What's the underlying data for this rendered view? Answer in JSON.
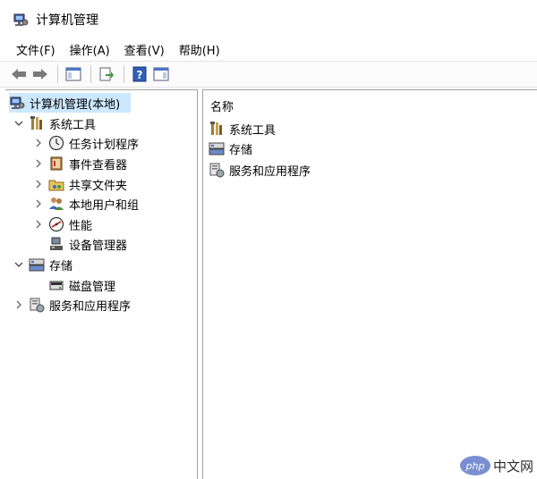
{
  "window": {
    "title": "计算机管理"
  },
  "menu": [
    {
      "label": "文件(F)"
    },
    {
      "label": "操作(A)"
    },
    {
      "label": "查看(V)"
    },
    {
      "label": "帮助(H)"
    }
  ],
  "toolbar": {
    "icons": [
      "back-icon",
      "forward-icon",
      "show-hide-tree-icon",
      "export-list-icon",
      "help-icon",
      "show-hide-action-pane-icon"
    ]
  },
  "tree": {
    "root": {
      "label": "计算机管理(本地)",
      "icon": "computer-management-icon"
    },
    "system_tools": {
      "label": "系统工具",
      "icon": "tools-icon",
      "children": [
        {
          "label": "任务计划程序",
          "icon": "clock-icon"
        },
        {
          "label": "事件查看器",
          "icon": "event-viewer-icon"
        },
        {
          "label": "共享文件夹",
          "icon": "shared-folder-icon"
        },
        {
          "label": "本地用户和组",
          "icon": "users-icon"
        },
        {
          "label": "性能",
          "icon": "performance-icon"
        },
        {
          "label": "设备管理器",
          "icon": "device-manager-icon"
        }
      ]
    },
    "storage": {
      "label": "存储",
      "icon": "storage-icon",
      "children": [
        {
          "label": "磁盘管理",
          "icon": "disk-icon"
        }
      ]
    },
    "services": {
      "label": "服务和应用程序",
      "icon": "services-icon"
    }
  },
  "list": {
    "column_name": "名称",
    "items": [
      {
        "label": "系统工具",
        "icon": "tools-icon"
      },
      {
        "label": "存储",
        "icon": "storage-icon"
      },
      {
        "label": "服务和应用程序",
        "icon": "services-icon"
      }
    ]
  },
  "watermark": {
    "badge": "php",
    "text": "中文网"
  }
}
